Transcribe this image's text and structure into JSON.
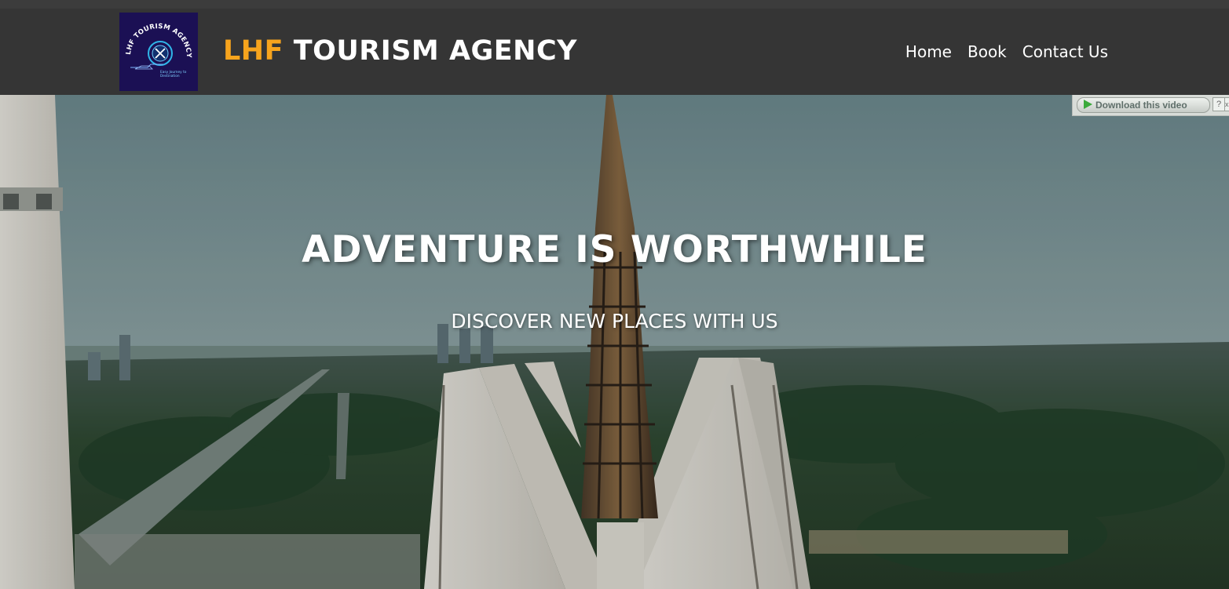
{
  "header": {
    "logo": {
      "ring_text": "LHF TOURISM AGENCY",
      "tagline_line1": "Easy Journey to",
      "tagline_line2": "Destination"
    },
    "brand_accent": "LHF",
    "brand_rest": " TOURISM AGENCY",
    "nav": [
      "Home",
      "Book",
      "Contact Us"
    ]
  },
  "hero": {
    "title": "ADVENTURE IS WORTHWHILE",
    "subtitle": "DISCOVER NEW PLACES WITH US"
  },
  "download_bar": {
    "label": "Download this video",
    "help": "?",
    "close": "x"
  },
  "colors": {
    "header_bg": "#353535",
    "brand_accent": "#f7a41d",
    "text": "#ffffff",
    "logo_bg": "#1b1054"
  },
  "icons": [
    "play-icon",
    "help-icon",
    "close-icon"
  ]
}
